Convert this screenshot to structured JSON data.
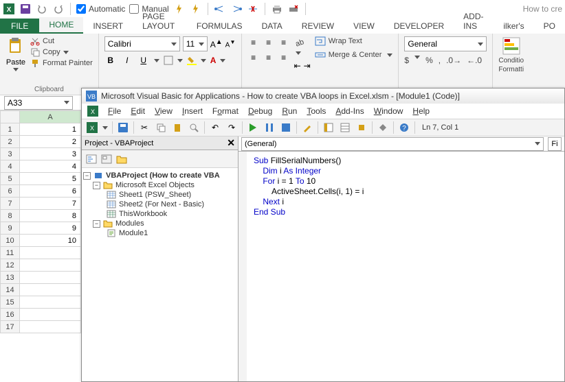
{
  "qat": {
    "automatic_label": "Automatic",
    "manual_label": "Manual",
    "truncated_title": "How to cre"
  },
  "ribbon": {
    "tabs": [
      "FILE",
      "HOME",
      "INSERT",
      "PAGE LAYOUT",
      "FORMULAS",
      "DATA",
      "REVIEW",
      "VIEW",
      "DEVELOPER",
      "ADD-INS",
      "ilker's",
      "PO"
    ],
    "clipboard": {
      "paste": "Paste",
      "cut": "Cut",
      "copy": "Copy",
      "format_painter": "Format Painter",
      "label": "Clipboard"
    },
    "font": {
      "name": "Calibri",
      "size": "11",
      "bold": "B",
      "italic": "I",
      "underline": "U"
    },
    "alignment": {
      "wrap": "Wrap Text",
      "merge": "Merge & Center"
    },
    "number": {
      "format": "General"
    },
    "styles": {
      "conditional": "Conditio",
      "formatting": "Formatti"
    }
  },
  "namebox": "A33",
  "sheet": {
    "col": "A",
    "rows": [
      {
        "n": 1,
        "v": "1"
      },
      {
        "n": 2,
        "v": "2"
      },
      {
        "n": 3,
        "v": "3"
      },
      {
        "n": 4,
        "v": "4"
      },
      {
        "n": 5,
        "v": "5"
      },
      {
        "n": 6,
        "v": "6"
      },
      {
        "n": 7,
        "v": "7"
      },
      {
        "n": 8,
        "v": "8"
      },
      {
        "n": 9,
        "v": "9"
      },
      {
        "n": 10,
        "v": "10"
      },
      {
        "n": 11,
        "v": ""
      },
      {
        "n": 12,
        "v": ""
      },
      {
        "n": 13,
        "v": ""
      },
      {
        "n": 14,
        "v": ""
      },
      {
        "n": 15,
        "v": ""
      },
      {
        "n": 16,
        "v": ""
      },
      {
        "n": 17,
        "v": ""
      }
    ]
  },
  "vba": {
    "title": "Microsoft Visual Basic for Applications - How to create VBA loops in Excel.xlsm - [Module1 (Code)]",
    "menu": [
      "File",
      "Edit",
      "View",
      "Insert",
      "Format",
      "Debug",
      "Run",
      "Tools",
      "Add-Ins",
      "Window",
      "Help"
    ],
    "cursor_pos": "Ln 7, Col 1",
    "project_pane_title": "Project - VBAProject",
    "tree": {
      "root": "VBAProject (How to create VBA",
      "excel_objects": "Microsoft Excel Objects",
      "sheet1": "Sheet1 (PSW_Sheet)",
      "sheet2": "Sheet2 (For Next - Basic)",
      "thisworkbook": "ThisWorkbook",
      "modules": "Modules",
      "module1": "Module1"
    },
    "code_dropdown": "(General)",
    "code_dropdown2": "Fi",
    "code": {
      "l1a": "Sub ",
      "l1b": "FillSerialNumbers()",
      "l2a": "    Dim ",
      "l2b": "i ",
      "l2c": "As Integer",
      "l3a": "    For ",
      "l3b": "i = 1 ",
      "l3c": "To ",
      "l3d": "10",
      "l4": "        ActiveSheet.Cells(i, 1) = i",
      "l5a": "    Next ",
      "l5b": "i",
      "l6": "End Sub"
    }
  }
}
